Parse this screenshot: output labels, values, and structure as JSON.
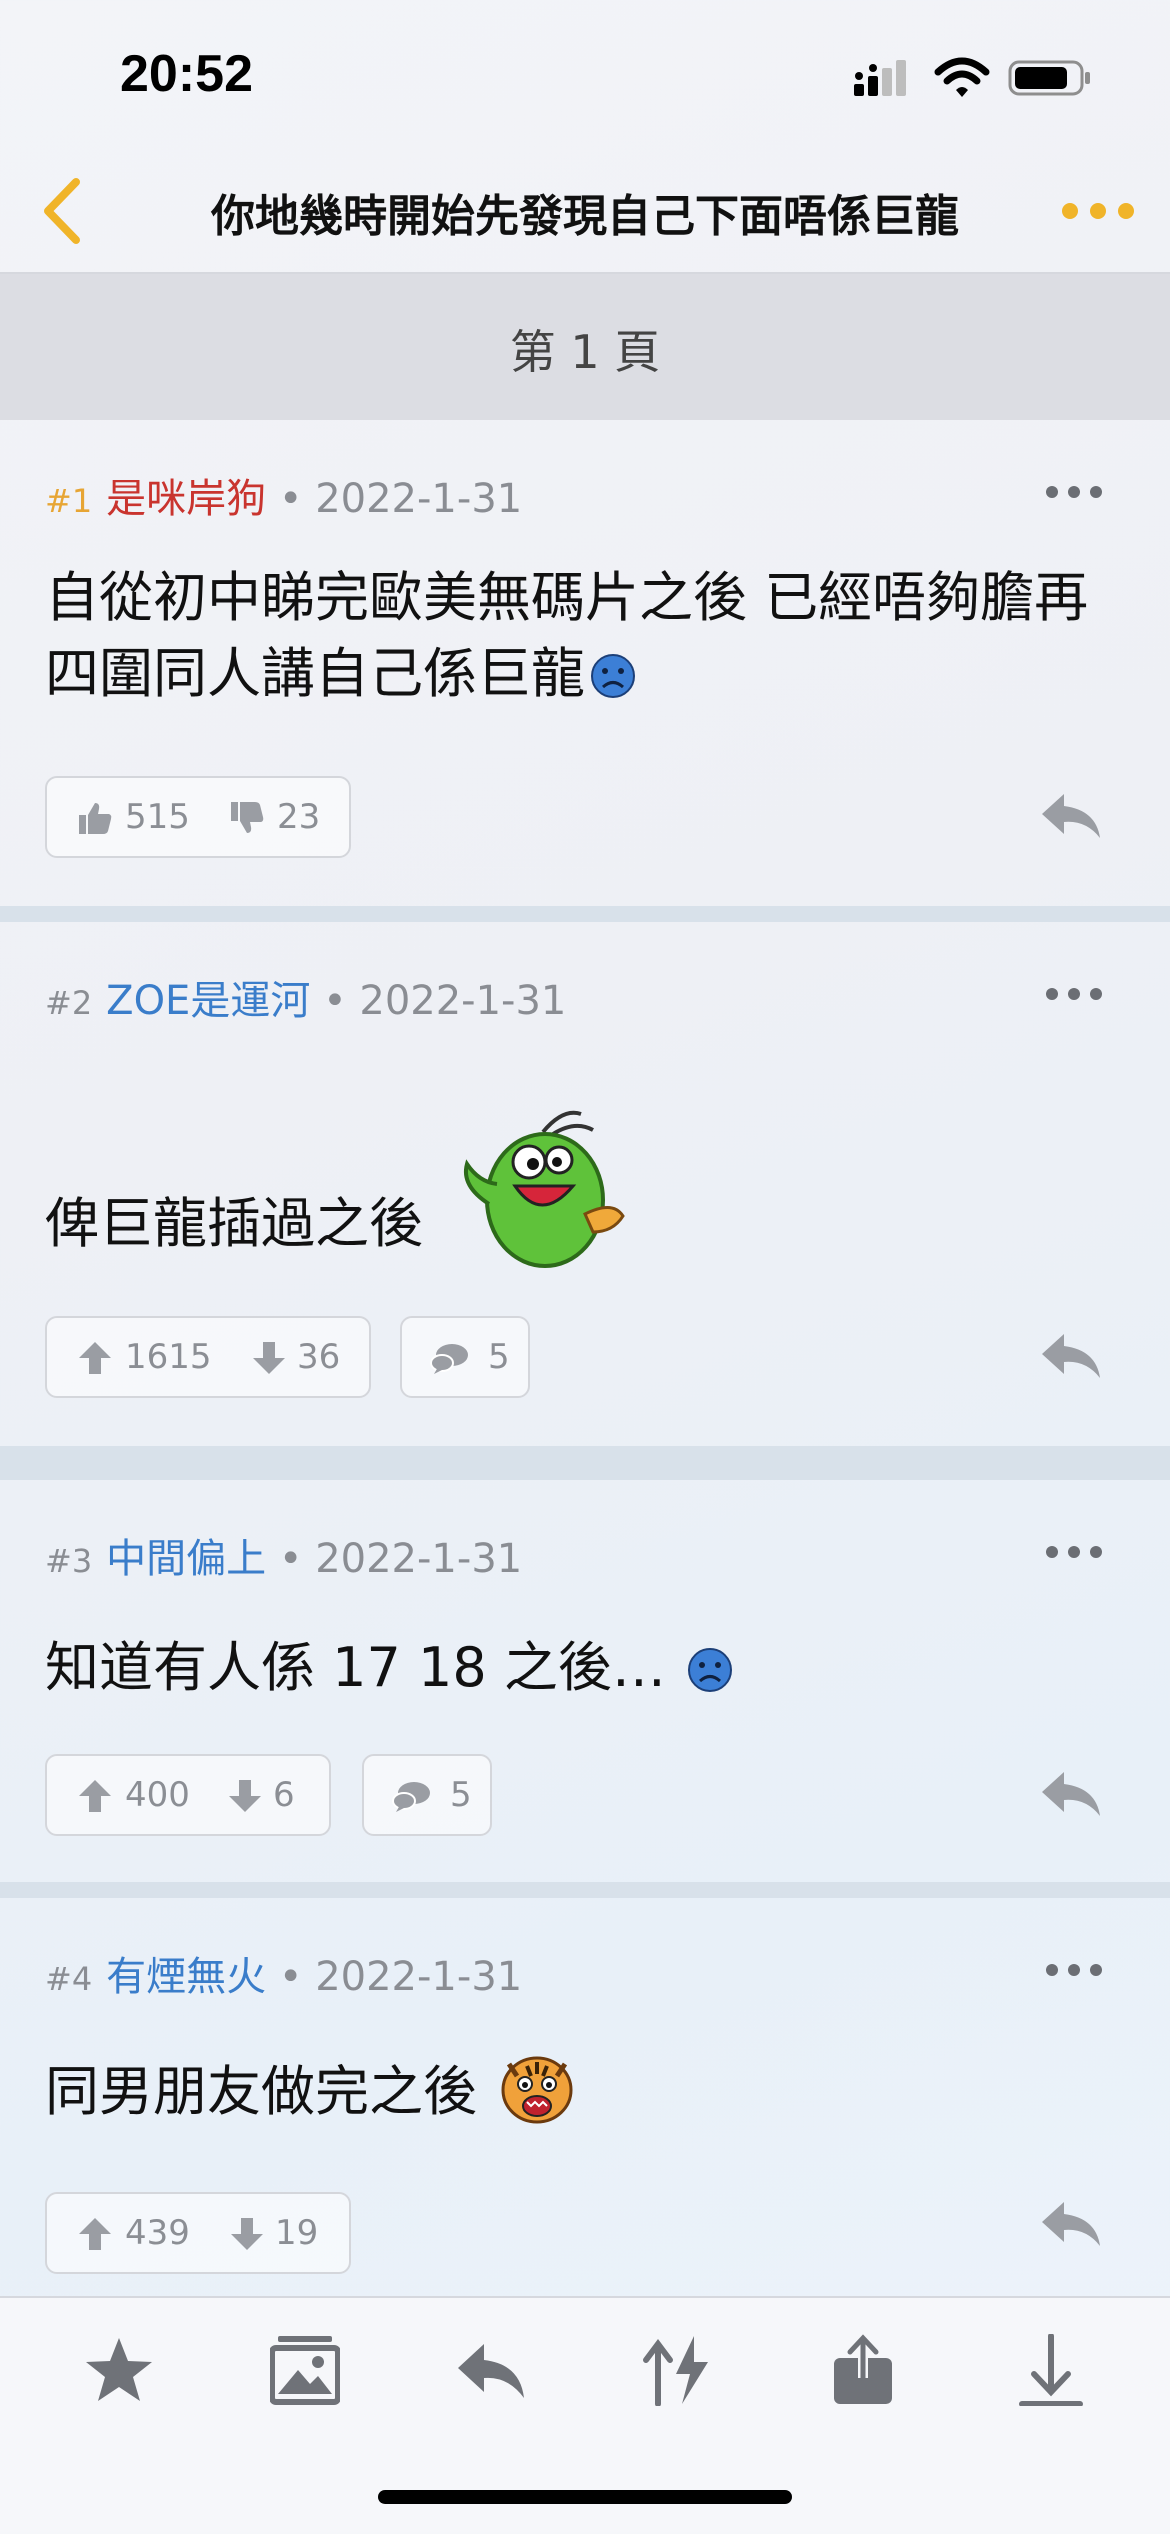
{
  "status": {
    "time": "20:52"
  },
  "nav": {
    "title": "你地幾時開始先發現自己下面唔係巨龍",
    "accent": "#f0b429"
  },
  "page_label": "第 1 頁",
  "posts": [
    {
      "num": "#1",
      "user": "是咪岸狗",
      "date": "• 2022-1-31",
      "text": "自從初中睇完歐美無碼片之後 已經唔夠膽再四圍同人講自己係巨龍",
      "emoji": "sad-face-icon",
      "up": "515",
      "down": "23",
      "vote_style": "thumbs"
    },
    {
      "num": "#2",
      "user": "ZOE是運河",
      "date": "• 2022-1-31",
      "text": "俾巨龍插過之後",
      "emoji": "green-bug-sticker",
      "up": "1615",
      "down": "36",
      "comments": "5"
    },
    {
      "num": "#3",
      "user": "中間偏上",
      "date": "• 2022-1-31",
      "text": "知道有人係 17 18 之後…",
      "emoji": "sad-face-icon",
      "up": "400",
      "down": "6",
      "comments": "5"
    },
    {
      "num": "#4",
      "user": "有煙無火",
      "date": "• 2022-1-31",
      "text": "同男朋友做完之後",
      "emoji": "tiger-sticker",
      "up": "439",
      "down": "19"
    }
  ],
  "toolbar": {
    "items": [
      "star-icon",
      "image-icon",
      "reply-icon",
      "sort-icon",
      "share-icon",
      "download-icon"
    ]
  }
}
